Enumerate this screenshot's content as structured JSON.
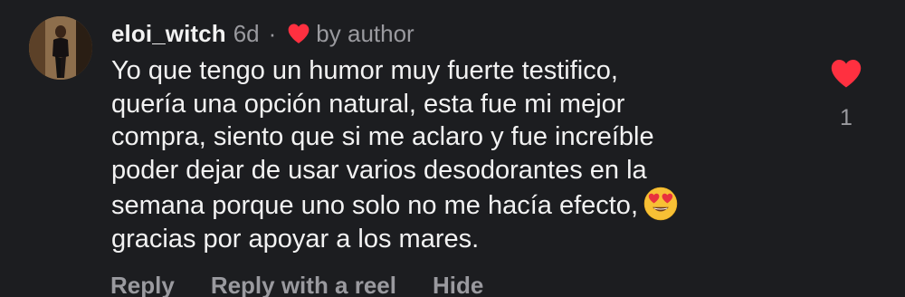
{
  "comment": {
    "username": "eloi_witch",
    "time": "6d",
    "separator": "·",
    "by_author": "by author",
    "lines": [
      "Yo que tengo un humor muy fuerte testifico,",
      "quería una opción natural, esta fue mi mejor",
      "compra, siento que si me aclaro y fue increíble",
      "poder dejar de usar varios desodorantes en la",
      "semana porque uno solo no me hacía efecto,",
      "gracias por apoyar a los mares."
    ],
    "emoji": "heart-eyes-emoji",
    "like_count": "1"
  },
  "actions": {
    "reply": "Reply",
    "reply_with_reel": "Reply with a reel",
    "hide": "Hide"
  },
  "colors": {
    "background": "#1c1d20",
    "text": "#f2f2f2",
    "muted": "#9a9a9f",
    "like_red": "#ff3040"
  },
  "icons": {
    "author_like": "heart-icon",
    "like_button": "heart-icon"
  }
}
